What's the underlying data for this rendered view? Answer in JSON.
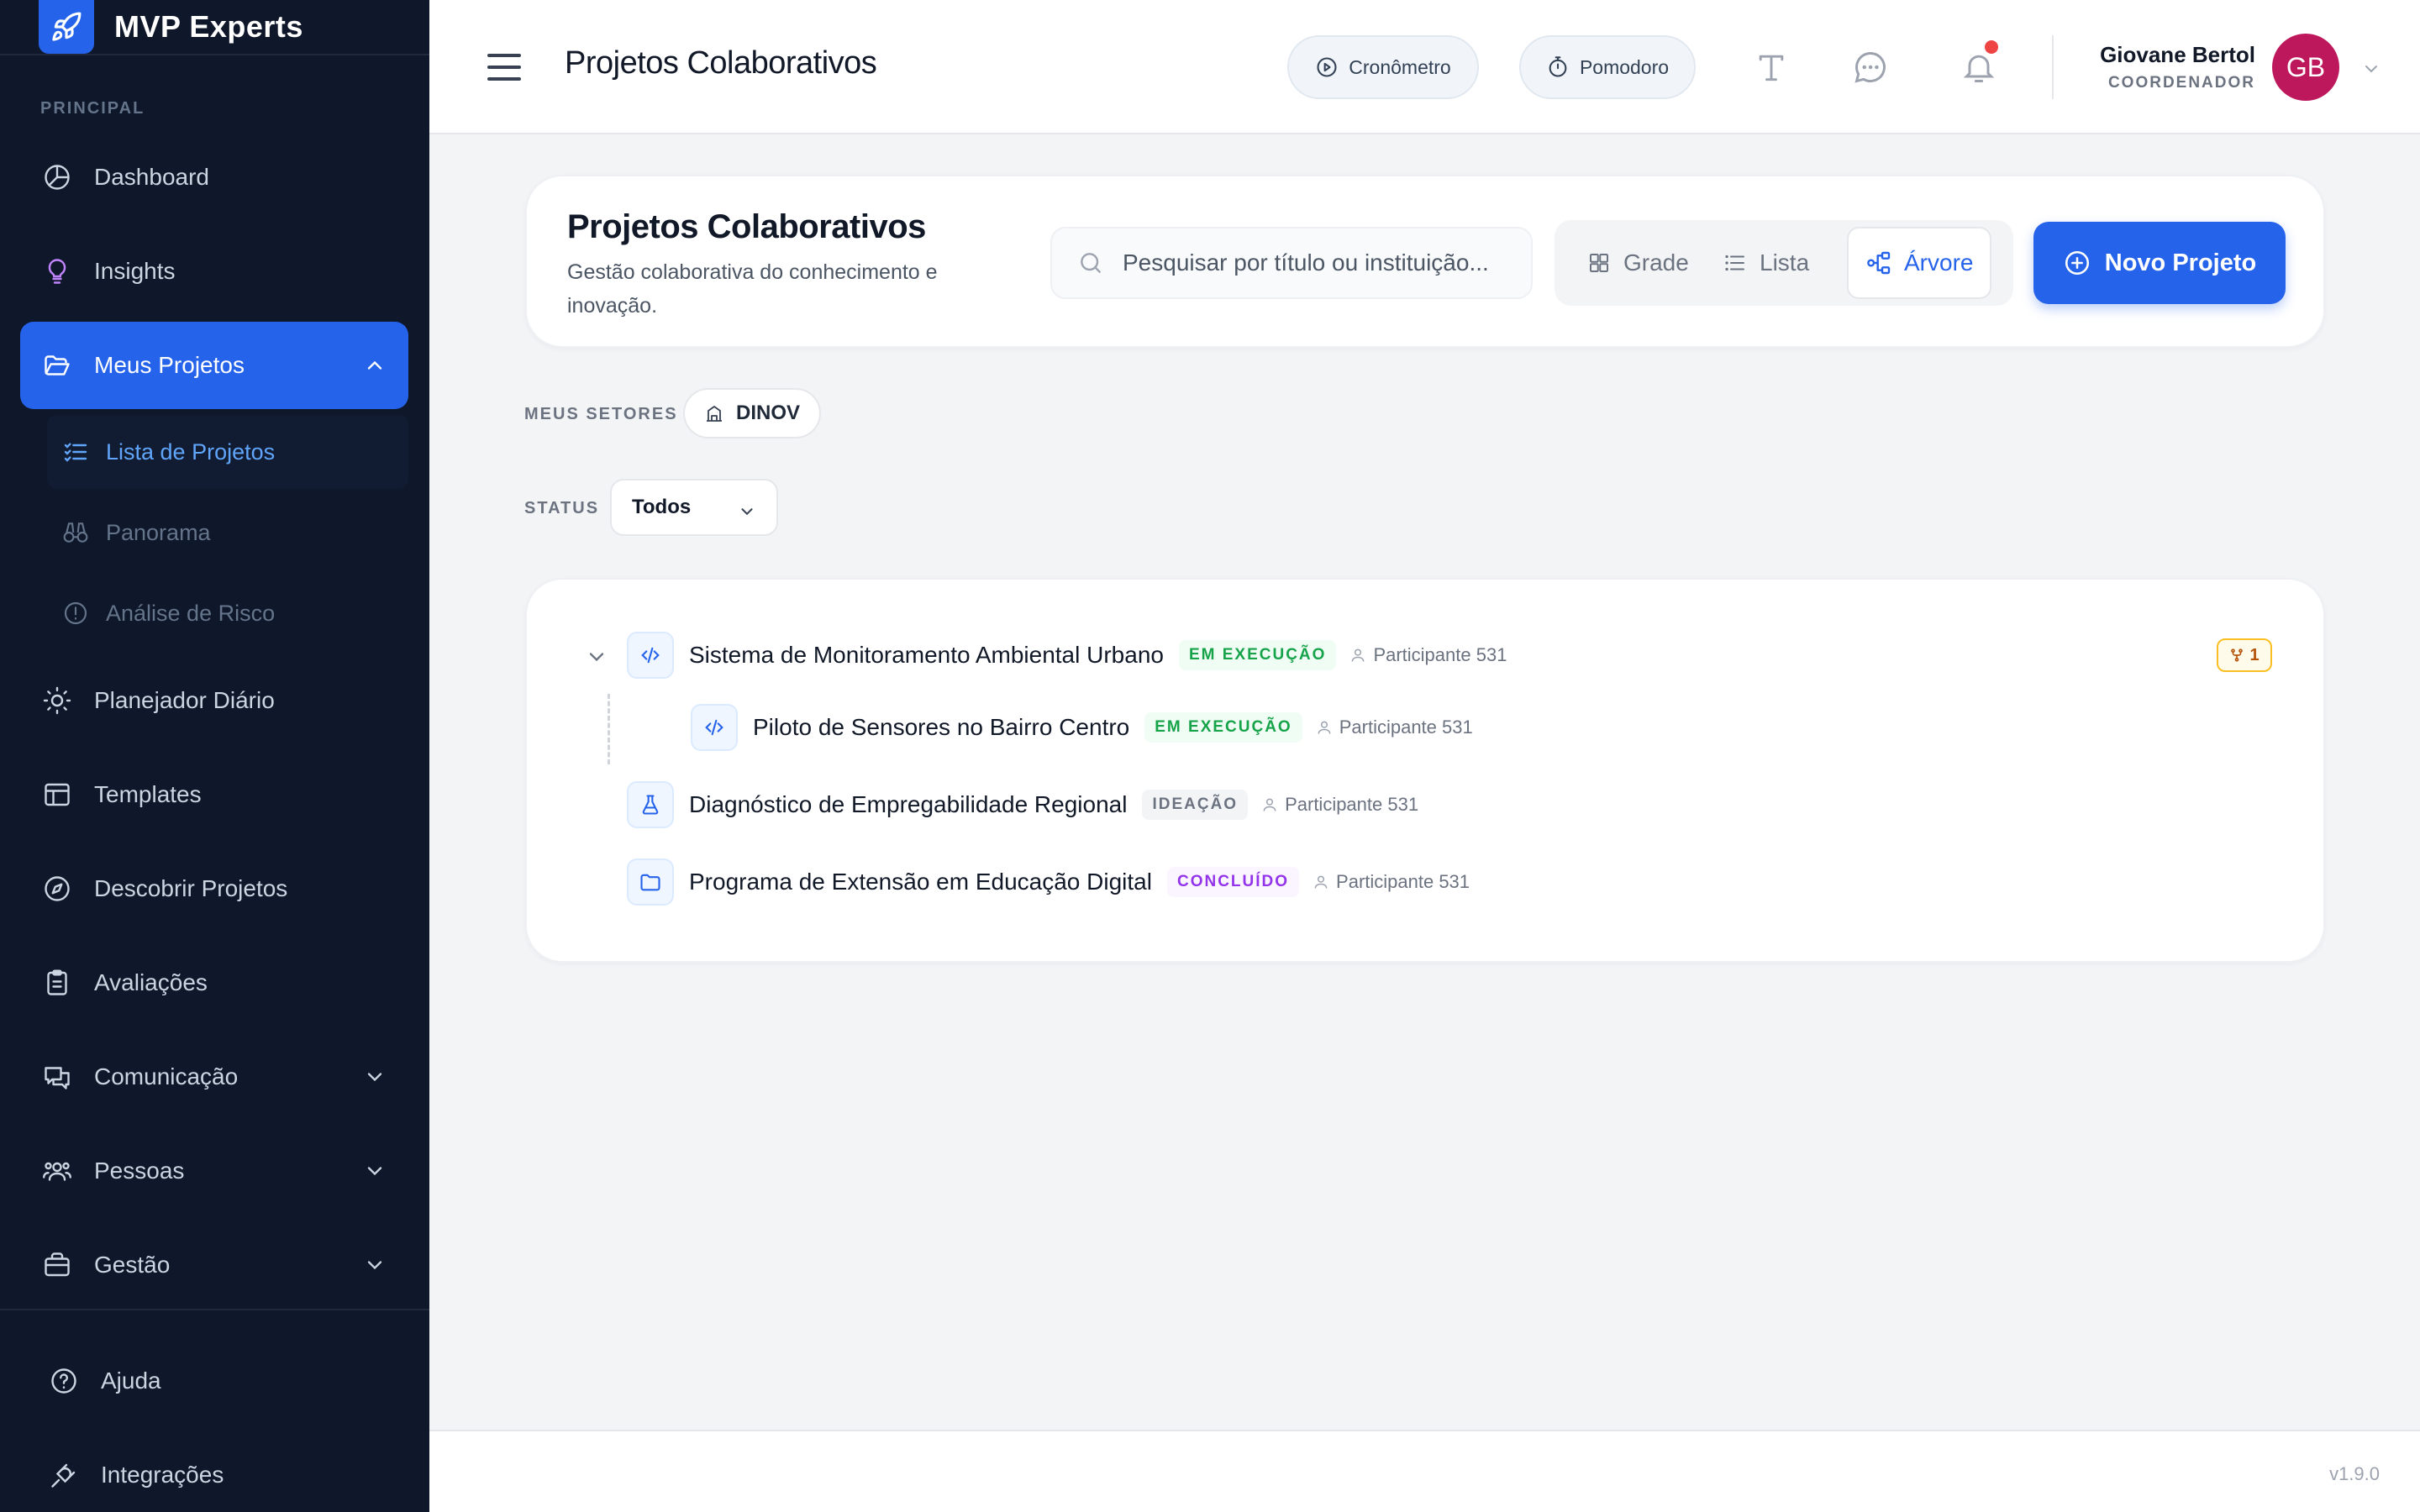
{
  "brand": {
    "name": "MVP Experts",
    "accent": "#2563eb"
  },
  "sidebar": {
    "section_label": "PRINCIPAL",
    "items": [
      {
        "label": "Dashboard",
        "icon": "chart-pie-icon"
      },
      {
        "label": "Insights",
        "icon": "lightbulb-icon"
      },
      {
        "label": "Meus Projetos",
        "icon": "folder-open-icon",
        "active": true,
        "expanded": true,
        "children": [
          {
            "label": "Lista de Projetos",
            "icon": "list-check-icon",
            "active": true
          },
          {
            "label": "Panorama",
            "icon": "binoculars-icon"
          },
          {
            "label": "Análise de Risco",
            "icon": "alert-circle-icon"
          }
        ]
      },
      {
        "label": "Planejador Diário",
        "icon": "sun-icon"
      },
      {
        "label": "Templates",
        "icon": "layout-icon"
      },
      {
        "label": "Descobrir Projetos",
        "icon": "compass-icon"
      },
      {
        "label": "Avaliações",
        "icon": "clipboard-icon"
      },
      {
        "label": "Comunicação",
        "icon": "chat-icon",
        "has_submenu": true
      },
      {
        "label": "Pessoas",
        "icon": "users-icon",
        "has_submenu": true
      },
      {
        "label": "Gestão",
        "icon": "briefcase-icon",
        "has_submenu": true
      }
    ],
    "bottom": [
      {
        "label": "Ajuda",
        "icon": "help-circle-icon"
      },
      {
        "label": "Integrações",
        "icon": "plug-icon"
      }
    ]
  },
  "header": {
    "title": "Projetos Colaborativos",
    "timer_label": "Cronômetro",
    "pomodoro_label": "Pomodoro",
    "user": {
      "name": "Giovane Bertol",
      "role": "COORDENADOR",
      "initials": "GB",
      "avatar_color": "#be185d"
    }
  },
  "main": {
    "title": "Projetos Colaborativos",
    "subtitle": "Gestão colaborativa do conhecimento e inovação.",
    "search_placeholder": "Pesquisar por título ou instituição...",
    "views": [
      {
        "label": "Grade",
        "active": false
      },
      {
        "label": "Lista",
        "active": false
      },
      {
        "label": "Árvore",
        "active": true
      }
    ],
    "new_project_label": "Novo Projeto",
    "filters": {
      "sectors_label": "MEUS SETORES",
      "sector_chip": "DINOV",
      "status_label": "STATUS",
      "status_value": "Todos"
    },
    "tree": [
      {
        "title": "Sistema de Monitoramento Ambiental Urbano",
        "status": "EM EXECUÇÃO",
        "participant": "Participante 531",
        "icon": "code-icon",
        "expanded": true,
        "forks": "1",
        "children": [
          {
            "title": "Piloto de Sensores no Bairro Centro",
            "status": "EM EXECUÇÃO",
            "participant": "Participante 531",
            "icon": "code-icon"
          }
        ]
      },
      {
        "title": "Diagnóstico de Empregabilidade Regional",
        "status": "IDEAÇÃO",
        "participant": "Participante 531",
        "icon": "flask-icon"
      },
      {
        "title": "Programa de Extensão em Educação Digital",
        "status": "CONCLUÍDO",
        "participant": "Participante 531",
        "icon": "folder-icon"
      }
    ]
  },
  "footer": {
    "version": "v1.9.0"
  }
}
